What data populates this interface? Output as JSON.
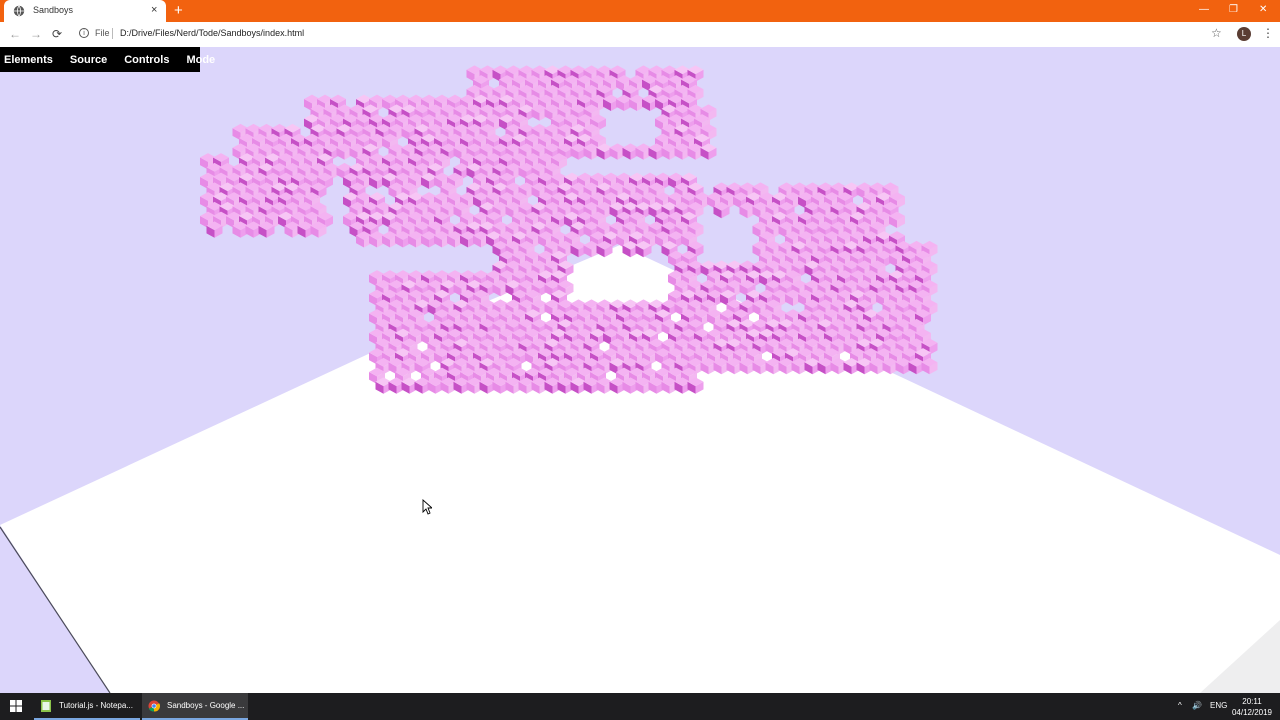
{
  "browser": {
    "tab_title": "Sandboys",
    "tab_close": "×",
    "new_tab": "+",
    "minimize": "—",
    "restore": "❐",
    "close": "✕",
    "back": "←",
    "forward": "→",
    "reload": "⟳",
    "scheme_label": "File",
    "url": "D:/Drive/Files/Nerd/Tode/Sandboys/index.html",
    "bookmark": "☆",
    "profile_initial": "L",
    "menu": "⋮",
    "accent": "#f2620f"
  },
  "page": {
    "menu": [
      {
        "label": "Elements"
      },
      {
        "label": "Source"
      },
      {
        "label": "Controls"
      },
      {
        "label": "Mode"
      }
    ],
    "background": "#dcd6fb",
    "ground_color": "#ffffff",
    "voxel_color": "#f0a2ee"
  },
  "taskbar": {
    "tasks": [
      {
        "label": "Tutorial.js - Notepa..."
      },
      {
        "label": "Sandboys - Google ..."
      }
    ],
    "tray_chevron": "^",
    "volume": "🔊",
    "language": "ENG",
    "time": "20:11",
    "date": "04/12/2019"
  }
}
